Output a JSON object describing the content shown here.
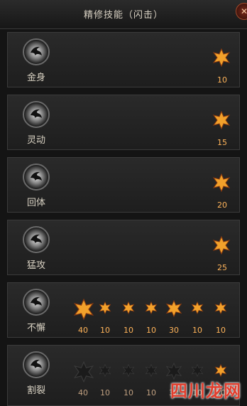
{
  "window": {
    "title": "精修技能（闪击）"
  },
  "skills": [
    {
      "name": "金身",
      "levels": [
        "10"
      ]
    },
    {
      "name": "灵动",
      "levels": [
        "15"
      ]
    },
    {
      "name": "回体",
      "levels": [
        "20"
      ]
    },
    {
      "name": "猛攻",
      "levels": [
        "25"
      ]
    },
    {
      "name": "不懈",
      "levels": [
        "40",
        "10",
        "10",
        "10",
        "30",
        "10",
        "10"
      ]
    },
    {
      "name": "割裂",
      "levels": [
        "40",
        "10",
        "10",
        "10",
        "30",
        "10",
        "10"
      ]
    }
  ],
  "watermark": {
    "text": "四川龙网"
  },
  "colors": {
    "active_star": "#f2a12b",
    "inactive_star": "#222222",
    "level_text": "#ffb45a"
  }
}
